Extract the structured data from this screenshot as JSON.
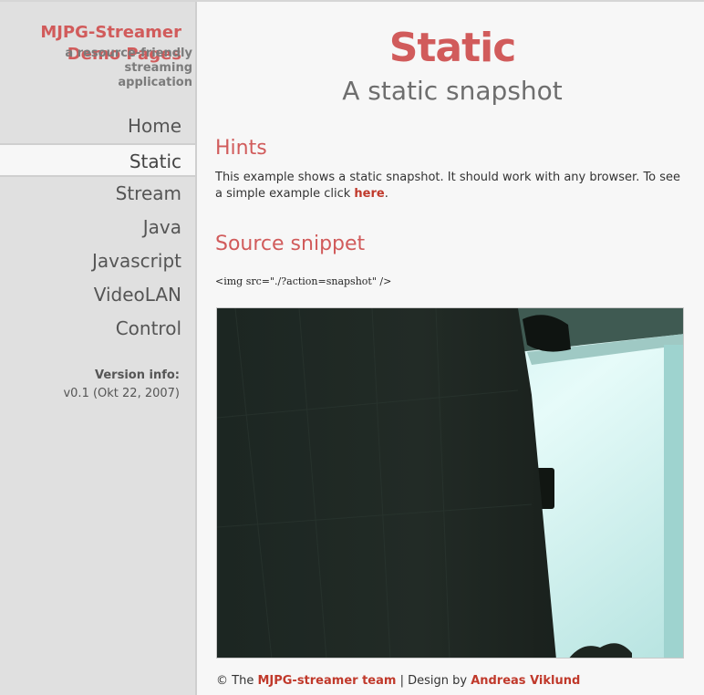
{
  "brand": {
    "title_line1": "MJPG-Streamer",
    "title_line2": "Demo Pages",
    "subtitle_line1": "a resource-friendly streaming",
    "subtitle_line2": "application"
  },
  "nav": {
    "items": [
      {
        "label": "Home"
      },
      {
        "label": "Static",
        "active": true
      },
      {
        "label": "Stream"
      },
      {
        "label": "Java"
      },
      {
        "label": "Javascript"
      },
      {
        "label": "VideoLAN"
      },
      {
        "label": "Control"
      }
    ]
  },
  "version": {
    "label": "Version info:",
    "value": "v0.1 (Okt 22, 2007)"
  },
  "page": {
    "title": "Static",
    "subtitle": "A static snapshot"
  },
  "hints": {
    "heading": "Hints",
    "text_before": "This example shows a static snapshot. It should work with any browser. To see a simple example click ",
    "link": "here",
    "text_after": "."
  },
  "snippet": {
    "heading": "Source snippet",
    "code": "<img src=\"./?action=snapshot\" />"
  },
  "footer": {
    "prefix": "© The ",
    "team_link": "MJPG-streamer team",
    "separator": " | Design by ",
    "designer_link": "Andreas Viklund"
  },
  "colors": {
    "accent": "#d15b5b",
    "sidebar_bg": "#e0e0e0",
    "page_bg": "#f7f7f7"
  }
}
